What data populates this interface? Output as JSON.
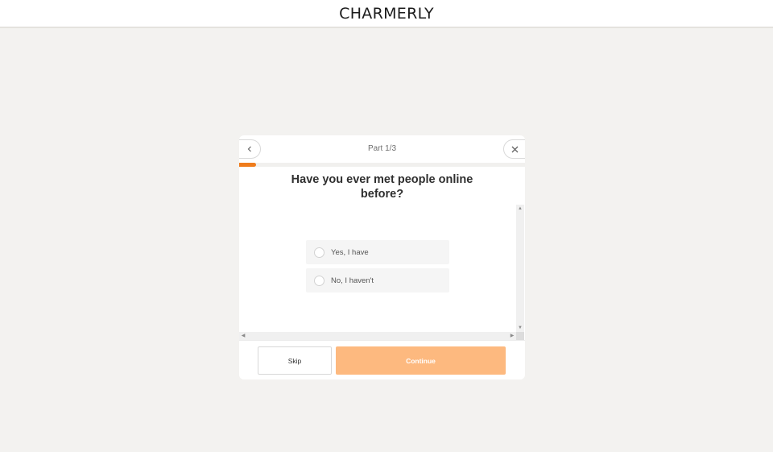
{
  "app": {
    "brand": "CHARMERLY"
  },
  "modal": {
    "part_label": "Part 1/3",
    "progress": 0.06,
    "back_icon": "chevron-left-icon",
    "close_icon": "close-icon",
    "question": "Have you ever met people online before?",
    "options": [
      {
        "label": "Yes, I have",
        "selected": false
      },
      {
        "label": "No, I haven't",
        "selected": false
      }
    ],
    "skip_label": "Skip",
    "continue_label": "Continue"
  },
  "colors": {
    "accent": "#ef7c1c",
    "continue_disabled": "#fdb97f",
    "page_background": "#f3f2f0"
  }
}
